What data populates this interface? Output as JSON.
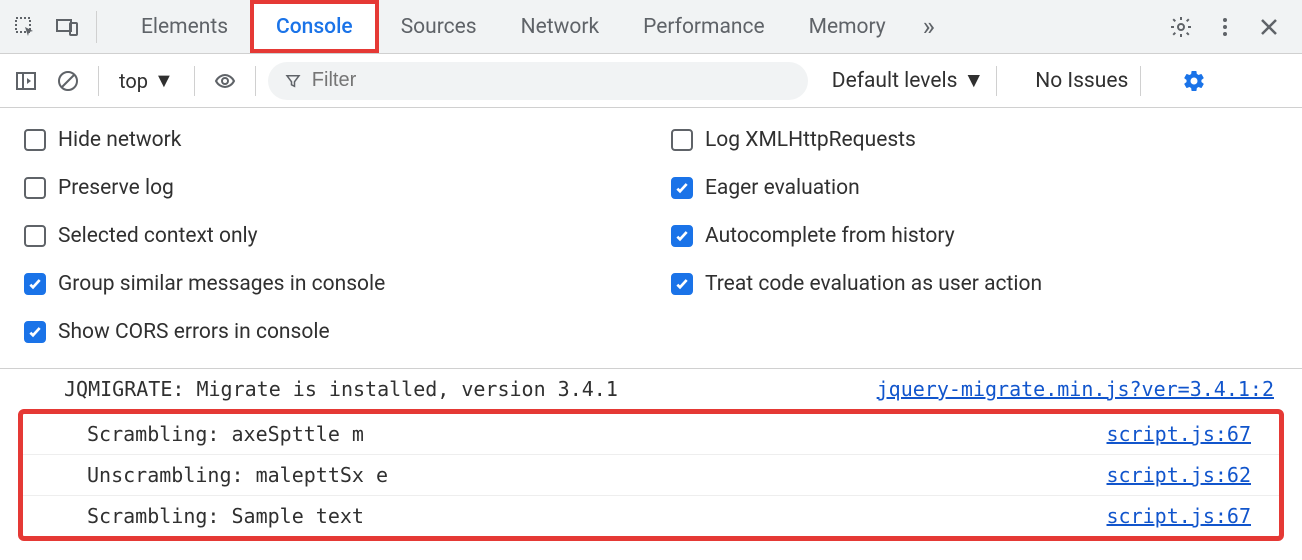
{
  "tabs": {
    "list": [
      {
        "label": "Elements"
      },
      {
        "label": "Console"
      },
      {
        "label": "Sources"
      },
      {
        "label": "Network"
      },
      {
        "label": "Performance"
      },
      {
        "label": "Memory"
      }
    ],
    "active": "Console"
  },
  "subbar": {
    "context": "top",
    "filter_placeholder": "Filter",
    "levels": "Default levels",
    "issues": "No Issues"
  },
  "settings": {
    "left": [
      {
        "label": "Hide network",
        "checked": false
      },
      {
        "label": "Preserve log",
        "checked": false
      },
      {
        "label": "Selected context only",
        "checked": false
      },
      {
        "label": "Group similar messages in console",
        "checked": true
      },
      {
        "label": "Show CORS errors in console",
        "checked": true
      }
    ],
    "right": [
      {
        "label": "Log XMLHttpRequests",
        "checked": false
      },
      {
        "label": "Eager evaluation",
        "checked": true
      },
      {
        "label": "Autocomplete from history",
        "checked": true
      },
      {
        "label": "Treat code evaluation as user action",
        "checked": true
      }
    ]
  },
  "logs": [
    {
      "message": "JQMIGRATE: Migrate is installed, version 3.4.1",
      "source": "jquery-migrate.min.js?ver=3.4.1:2",
      "highlighted": false
    },
    {
      "message": "Scrambling: axeSpttle m",
      "source": "script.js:67",
      "highlighted": true
    },
    {
      "message": "Unscrambling: malepttSx e",
      "source": "script.js:62",
      "highlighted": true
    },
    {
      "message": "Scrambling: Sample text",
      "source": "script.js:67",
      "highlighted": true
    }
  ]
}
